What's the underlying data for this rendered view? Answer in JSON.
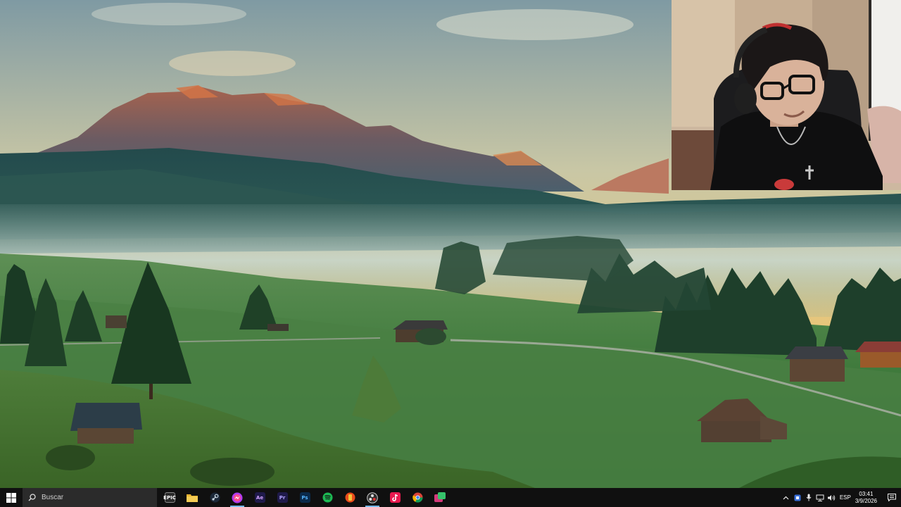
{
  "wallpaper": {
    "description_icon": "landscape-wallpaper"
  },
  "webcam": {
    "icon": "webcam-feed"
  },
  "taskbar": {
    "start_icon": "windows-logo-icon",
    "search": {
      "icon": "search-icon",
      "placeholder": "Buscar"
    },
    "apps": [
      {
        "name": "epic-games",
        "label": "EPIC",
        "color": "#2a2a2a",
        "active": false
      },
      {
        "name": "file-explorer",
        "label": "",
        "color": "#e8b330",
        "active": false
      },
      {
        "name": "steam",
        "label": "",
        "color": "#1b2838",
        "active": false
      },
      {
        "name": "messenger",
        "label": "",
        "color": "#a33bf0",
        "active": true
      },
      {
        "name": "after-effects",
        "label": "Ae",
        "color": "#1f1a4a",
        "active": false
      },
      {
        "name": "premiere-pro",
        "label": "Pr",
        "color": "#1f1a4a",
        "active": false
      },
      {
        "name": "photoshop",
        "label": "Ps",
        "color": "#0b2a4a",
        "active": false
      },
      {
        "name": "spotify",
        "label": "",
        "color": "#1db954",
        "active": false
      },
      {
        "name": "game-app",
        "label": "",
        "color": "#e84b1c",
        "active": false
      },
      {
        "name": "obs-studio",
        "label": "",
        "color": "#2f2f2f",
        "active": true
      },
      {
        "name": "tiktok",
        "label": "",
        "color": "#111111",
        "active": false
      },
      {
        "name": "chrome",
        "label": "",
        "color": "#e0e0e0",
        "active": false
      },
      {
        "name": "media-app",
        "label": "",
        "color": "#d43a7a",
        "active": false
      }
    ],
    "tray": {
      "language": "ESP",
      "time": "03:41",
      "date": "3/9/2026"
    }
  }
}
